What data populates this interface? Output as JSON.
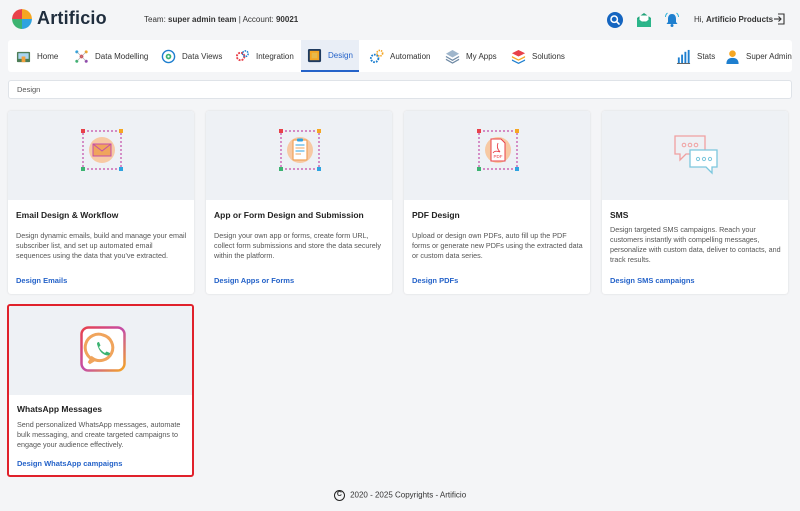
{
  "app": {
    "name": "Artificio"
  },
  "header": {
    "team_label": "Team:",
    "team_name": "super admin team",
    "separator": "|",
    "account_label": "Account:",
    "account_number": "90021",
    "greeting": "Hi,",
    "user_name": "Artificio Products"
  },
  "nav": {
    "items": [
      {
        "label": "Home",
        "icon": "home-icon"
      },
      {
        "label": "Data Modelling",
        "icon": "data-modelling-icon"
      },
      {
        "label": "Data Views",
        "icon": "data-views-icon"
      },
      {
        "label": "Integration",
        "icon": "integration-icon"
      },
      {
        "label": "Design",
        "icon": "design-icon"
      },
      {
        "label": "Automation",
        "icon": "automation-icon"
      },
      {
        "label": "My Apps",
        "icon": "my-apps-icon"
      },
      {
        "label": "Solutions",
        "icon": "solutions-icon"
      }
    ],
    "active": "Design",
    "right": [
      {
        "label": "Stats",
        "icon": "stats-icon"
      },
      {
        "label": "Super Admin",
        "icon": "user-icon"
      }
    ]
  },
  "breadcrumb": {
    "current": "Design"
  },
  "cards": [
    {
      "title": "Email Design & Workflow",
      "description": "Design dynamic emails, build and manage your email subscriber list, and set up automated email sequences using the data that you've extracted.",
      "link": "Design Emails",
      "icon": "email-icon"
    },
    {
      "title": "App or Form Design and Submission",
      "description": "Design your own app or forms, create form URL, collect form submissions and store the data securely within the platform.",
      "link": "Design Apps or Forms",
      "icon": "form-icon"
    },
    {
      "title": "PDF Design",
      "description": "Upload or design own PDFs, auto fill up the PDF forms or generate new PDFs using the extracted data or custom data series.",
      "link": "Design PDFs",
      "icon": "pdf-icon",
      "icon_text": "PDF"
    },
    {
      "title": "SMS",
      "description": "Design targeted SMS campaigns. Reach your customers instantly with compelling messages, personalize with custom data, deliver to contacts, and track results.",
      "link": "Design SMS campaigns",
      "icon": "sms-icon"
    },
    {
      "title": "WhatsApp Messages",
      "description": "Send personalized WhatsApp messages, automate bulk messaging, and create targeted campaigns to engage your audience effectively.",
      "link": "Design WhatsApp campaigns",
      "icon": "whatsapp-icon"
    }
  ],
  "footer": {
    "text": "2020 - 2025 Copyrights - Artificio",
    "copyright_symbol": "C"
  },
  "colors": {
    "accent": "#2563c9",
    "selected_border": "#e0212b",
    "card_image_bg": "#eef1f5"
  }
}
